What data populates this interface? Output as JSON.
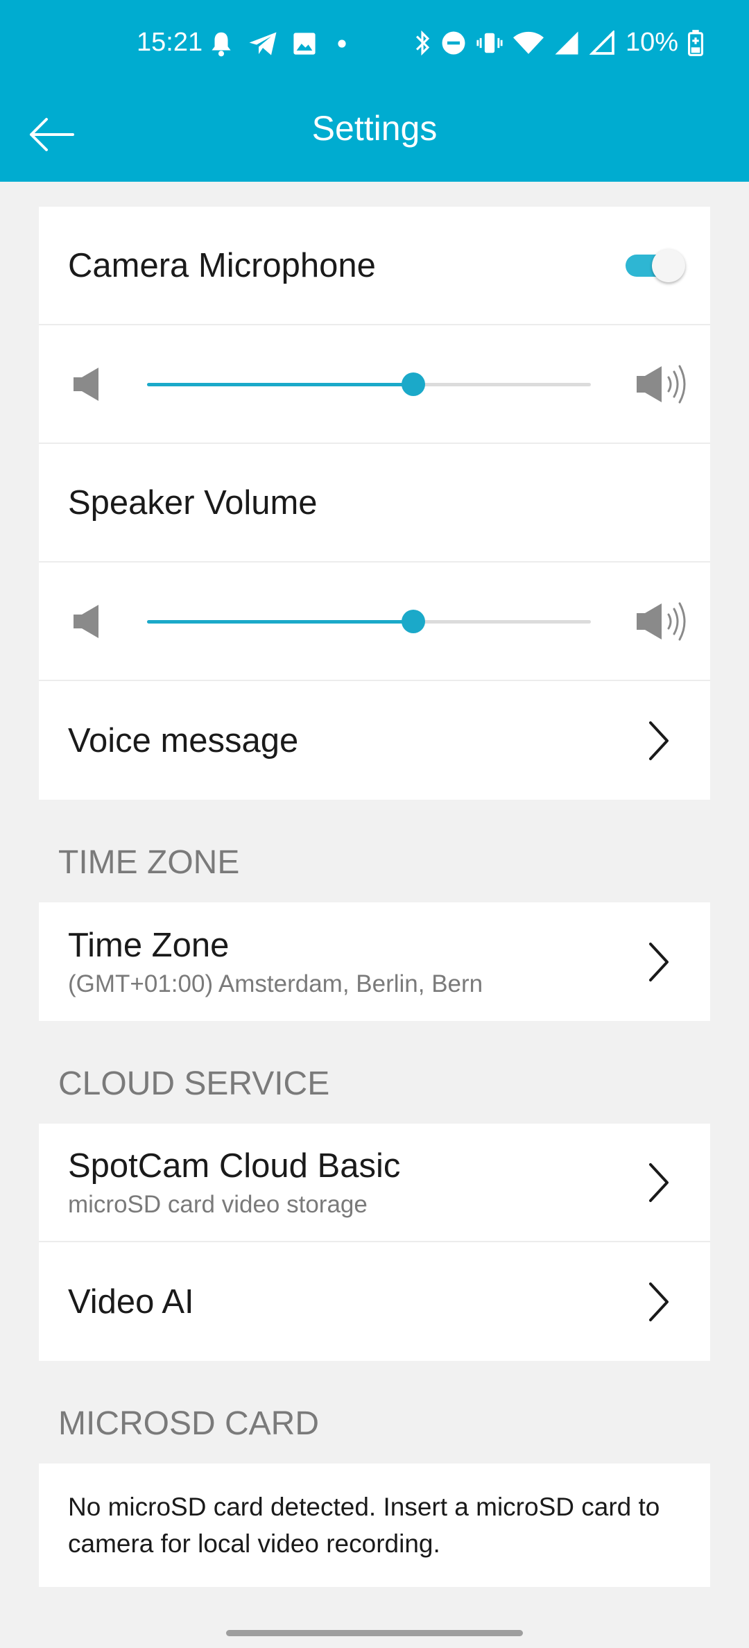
{
  "status_bar": {
    "time": "15:21",
    "battery": "10%",
    "left_icons": [
      "bell-icon",
      "telegram-icon",
      "image-icon",
      "dot-icon"
    ],
    "right_icons": [
      "bluetooth-icon",
      "do-not-disturb-icon",
      "vibrate-icon",
      "wifi-icon",
      "signal-icon",
      "signal-icon",
      "battery-icon"
    ]
  },
  "app_bar": {
    "title": "Settings",
    "back_icon": "arrow-left-icon"
  },
  "audio_card": {
    "camera_microphone": {
      "label": "Camera Microphone",
      "enabled": true
    },
    "microphone_volume_percent": 60,
    "speaker_volume": {
      "label": "Speaker Volume"
    },
    "speaker_volume_percent": 60,
    "voice_message": {
      "label": "Voice message"
    }
  },
  "time_zone_section": {
    "header": "TIME ZONE",
    "item": {
      "label": "Time Zone",
      "value": "(GMT+01:00) Amsterdam, Berlin, Bern"
    }
  },
  "cloud_section": {
    "header": "CLOUD SERVICE",
    "items": [
      {
        "label": "SpotCam Cloud Basic",
        "sub": "microSD card video storage"
      },
      {
        "label": "Video AI"
      }
    ]
  },
  "microsd_section": {
    "header": "MICROSD CARD",
    "message": "No microSD card detected. Insert a microSD card to camera for local video recording."
  },
  "colors": {
    "accent": "#00acd0",
    "slider": "#1ba9c9",
    "background": "#f1f1f1",
    "card": "#ffffff",
    "secondary_text": "#7a7a7a"
  }
}
